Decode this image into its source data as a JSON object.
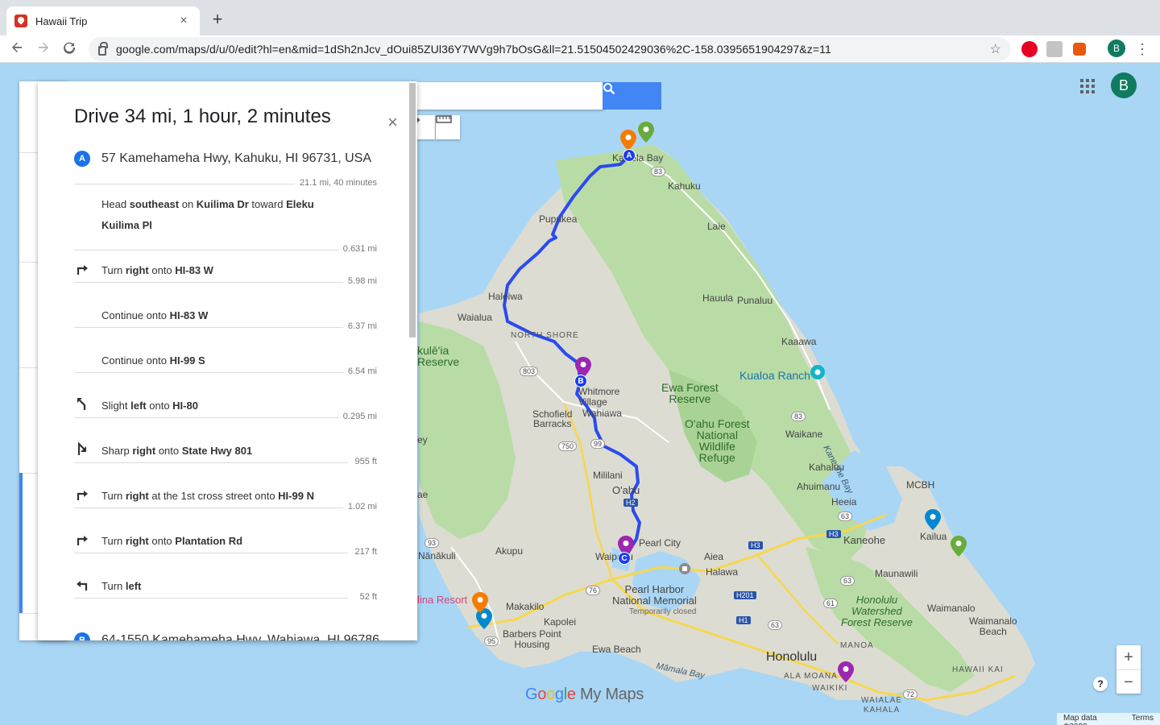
{
  "browser": {
    "tab_title": "Hawaii Trip",
    "tab_close": "×",
    "new_tab": "+",
    "url": "google.com/maps/d/u/0/edit?hl=en&mid=1dSh2nJcv_dOui85ZUl36Y7WVg9h7bOsG&ll=21.51504502429036%2C-158.0395651904297&z=11",
    "profile_initial": "B"
  },
  "map": {
    "profile_initial": "B",
    "brand": "My Maps",
    "attribution": {
      "data": "Map data ©2020",
      "terms": "Terms"
    },
    "zoom_in": "+",
    "zoom_out": "−",
    "help": "?",
    "labels": {
      "kawela_bay": "Kawela Bay",
      "kahuku": "Kahuku",
      "pupukea": "Pupukea",
      "laie": "Laie",
      "haleiwa": "Haleiwa",
      "waialua": "Waialua",
      "hauula": "Hauula",
      "punaluu": "Punaluu",
      "north_shore": "NORTH SHORE",
      "kaaawa": "Kaaawa",
      "kukaniloko": "kulē'ia\nReserve",
      "kualoa_ranch": "Kualoa Ranch",
      "whitmore": "Whitmore\nVillage",
      "wahiawa": "Wahiawa",
      "ewa_forest": "Ewa Forest\nReserve",
      "oahu_forest": "O'ahu Forest\nNational\nWildlife\nRefuge",
      "schofield": "Schofield\nBarracks",
      "waikane": "Waikane",
      "kaneohe_bay": "Kaneohe Bay",
      "kahaluu": "Kahaluu",
      "mililani": "Mililani",
      "oahu": "O'ahu",
      "ahuimanu": "Ahuimanu",
      "mcbh": "MCBH",
      "heeia": "Heeia",
      "kaneohe": "Kaneohe",
      "kailua": "Kailua",
      "pearl_city": "Pearl City",
      "waipahu": "Waipahu",
      "aiea": "Aiea",
      "maunawili": "Maunawili",
      "nanakuli": "Nānākuli",
      "akupu": "Akupu",
      "halawa": "Halawa",
      "makakilo": "Makakilo",
      "pearl_harbor": "Pearl Harbor\nNational Memorial",
      "temporarily_closed": "Temporarily closed",
      "kapolei": "Kapolei",
      "honolulu_watershed": "Honolulu\nWatershed\nForest Reserve",
      "waimanalo": "Waimanalo",
      "waimanalo_beach": "Waimanalo\nBeach",
      "barbers_point": "Barbers Point\nHousing",
      "ewa_beach": "Ewa Beach",
      "mamala_bay": "Māmala Bay",
      "honolulu": "Honolulu",
      "ala_moana": "ALA MOANA",
      "waikiki": "WAIKIKI",
      "manoa": "MANOA",
      "hawaii_kai": "HAWAII KAI",
      "waialae_kahala": "WAIALAE\nKAHALA",
      "ko_olina": "lina Resort",
      "hwy_83": "83",
      "hwy_803": "803",
      "hwy_750": "750",
      "hwy_99": "99",
      "hwy_93": "93",
      "hwy_76": "76",
      "hwy_95": "95",
      "hwy_63": "63",
      "hwy_61": "61",
      "hwy_72": "72",
      "h1": "H1",
      "h2": "H2",
      "h3": "H3",
      "h201": "H201",
      "ae": "ae",
      "ey": "ey"
    },
    "route_markers": [
      "A",
      "B",
      "C"
    ],
    "colors": {
      "route": "#2a4bf0",
      "pin_orange": "#f57c00",
      "pin_green": "#67ac3c",
      "pin_purple": "#9c27b0",
      "pin_blue": "#0288d1",
      "search_button": "#4285f4"
    }
  },
  "directions": {
    "title": "Drive 34 mi, 1 hour, 2 minutes",
    "close": "×",
    "origin": {
      "badge": "A",
      "address": "57 Kamehameha Hwy, Kahuku, HI 96731, USA"
    },
    "leg_summary": "21.1 mi, 40 minutes",
    "steps": [
      {
        "icon": "none",
        "parts": [
          "Head ",
          "southeast",
          " on ",
          "Kuilima Dr",
          " toward ",
          "Eleku Kuilima Pl"
        ],
        "distance": "0.631 mi"
      },
      {
        "icon": "turn-right",
        "parts": [
          "Turn ",
          "right",
          " onto ",
          "HI-83 W"
        ],
        "distance": "5.98 mi"
      },
      {
        "icon": "none",
        "parts": [
          "Continue onto ",
          "HI-83 W"
        ],
        "distance": "6.37 mi"
      },
      {
        "icon": "none",
        "parts": [
          "Continue onto ",
          "HI-99 S"
        ],
        "distance": "6.54 mi"
      },
      {
        "icon": "slight-left",
        "parts": [
          "Slight ",
          "left",
          " onto ",
          "HI-80"
        ],
        "distance": "0.295 mi"
      },
      {
        "icon": "sharp-right",
        "parts": [
          "Sharp ",
          "right",
          " onto ",
          "State Hwy 801"
        ],
        "distance": "955 ft"
      },
      {
        "icon": "turn-right",
        "parts": [
          "Turn ",
          "right",
          " at the 1st cross street onto ",
          "HI-99 N"
        ],
        "distance": "1.02 mi"
      },
      {
        "icon": "turn-right",
        "parts": [
          "Turn ",
          "right",
          " onto ",
          "Plantation Rd"
        ],
        "distance": "217 ft"
      },
      {
        "icon": "turn-left",
        "parts": [
          "Turn ",
          "left"
        ],
        "distance": "52 ft"
      }
    ],
    "next_waypoint": {
      "badge": "B",
      "address": "64-1550 Kamehameha Hwy, Wahiawa, HI 96786"
    }
  }
}
